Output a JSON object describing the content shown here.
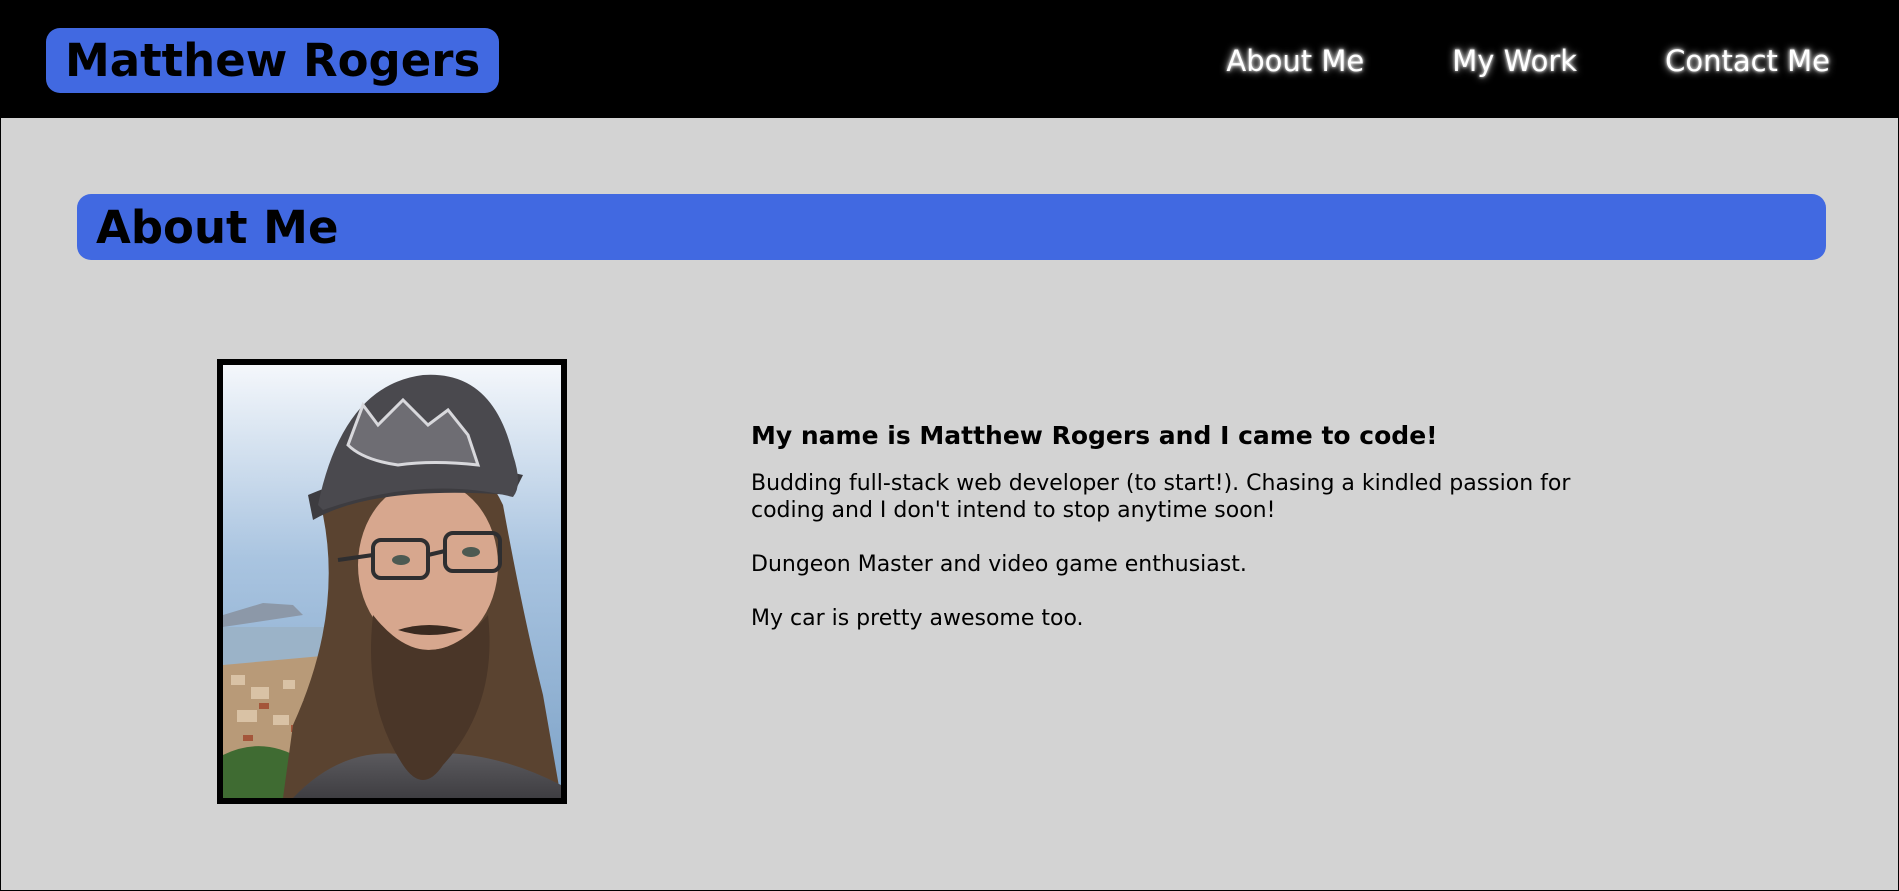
{
  "header": {
    "brand": "Matthew Rogers",
    "nav": [
      {
        "label": "About Me"
      },
      {
        "label": "My Work"
      },
      {
        "label": "Contact Me"
      }
    ]
  },
  "about": {
    "heading": "About Me",
    "intro": "My name is Matthew Rogers and I came to code!",
    "paragraphs": [
      "Budding full-stack web developer (to start!). Chasing a kindled passion for coding and I don't intend to stop anytime soon!",
      "Dungeon Master and video game enthusiast.",
      "My car is pretty awesome too."
    ]
  },
  "colors": {
    "accent": "#4169e1",
    "header_bg": "#000000",
    "page_bg": "#d3d3d3"
  }
}
